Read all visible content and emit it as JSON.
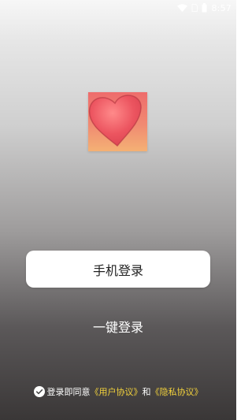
{
  "status_bar": {
    "time": "8:57",
    "icons": [
      "wifi-icon",
      "sim-icon",
      "battery-icon"
    ]
  },
  "logo": {
    "icon": "heart-icon",
    "colors": {
      "top": "#ee6c6c",
      "bottom": "#f4b174",
      "heart": "#e84b55"
    }
  },
  "buttons": {
    "phone_login": "手机登录",
    "one_click_login": "一键登录"
  },
  "agreement": {
    "checkbox_icon": "check-circle-icon",
    "prefix": "登录即同意",
    "user_agreement": "《用户协议》",
    "conjunction": "和",
    "privacy_agreement": "《隐私协议》",
    "link_color": "#f3d23c"
  }
}
